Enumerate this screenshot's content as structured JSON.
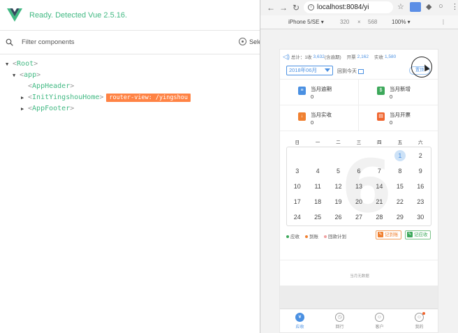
{
  "devtools": {
    "status": "Ready. Detected Vue 2.5.16.",
    "filter_placeholder": "Filter components",
    "select_label": "Sele",
    "tree": [
      {
        "name": "Root",
        "indent": 0,
        "arrow": "▼"
      },
      {
        "name": "app",
        "indent": 1,
        "arrow": "▼"
      },
      {
        "name": "AppHeader",
        "indent": 2,
        "arrow": ""
      },
      {
        "name": "InitYingshouHome",
        "indent": 2,
        "arrow": "▶",
        "badge": "router-view: /yingshou"
      },
      {
        "name": "AppFooter",
        "indent": 2,
        "arrow": "▶"
      }
    ],
    "accent": "#42b983"
  },
  "browser": {
    "url": "localhost:8084/yi",
    "device": "iPhone 5/SE ▾",
    "width": "320",
    "times": "×",
    "height": "568",
    "zoom": "100% ▾"
  },
  "page": {
    "summary": {
      "total_label": "总计：1收",
      "total_value": "3,632",
      "total_suffix": "(含逾期)",
      "invoice_label": "开票",
      "invoice_value": "2,162",
      "received_label": "实收",
      "received_value": "1,580"
    },
    "month": "2018年06月",
    "back_today": "回到今天",
    "top_button": "置顶",
    "stats": [
      {
        "label": "当月逾期",
        "value": "0",
        "color": "#4a90e2",
        "icon": "≡"
      },
      {
        "label": "当月新增",
        "value": "0",
        "color": "#3ca85a",
        "icon": "$"
      },
      {
        "label": "当月实收",
        "value": "0",
        "color": "#f08030",
        "icon": "↓"
      },
      {
        "label": "当月开票",
        "value": "0",
        "color": "#f0642d",
        "icon": "▤"
      }
    ],
    "weekdays": [
      "日",
      "一",
      "二",
      "三",
      "四",
      "五",
      "六"
    ],
    "month_number": "6",
    "days": [
      "",
      "",
      "",
      "",
      "",
      "1",
      "2",
      "3",
      "4",
      "5",
      "6",
      "7",
      "8",
      "9",
      "10",
      "11",
      "12",
      "13",
      "14",
      "15",
      "16",
      "17",
      "18",
      "19",
      "20",
      "21",
      "22",
      "23",
      "24",
      "25",
      "26",
      "27",
      "28",
      "29",
      "30"
    ],
    "today": "1",
    "legend": [
      {
        "label": "应收",
        "color": "#3ca85a"
      },
      {
        "label": "到账",
        "color": "#f08030"
      },
      {
        "label": "回款计划",
        "color": "#f0a0a0"
      }
    ],
    "btn_mark_received": "记到账",
    "btn_mark_due": "记应收",
    "empty_text": "当月无数据",
    "tabs": [
      {
        "label": "应收",
        "icon": "¥",
        "active": true
      },
      {
        "label": "回行",
        "icon": "◷",
        "active": false
      },
      {
        "label": "客户",
        "icon": "☺",
        "active": false
      },
      {
        "label": "我的",
        "icon": "☺",
        "active": false,
        "badge": true
      }
    ]
  }
}
